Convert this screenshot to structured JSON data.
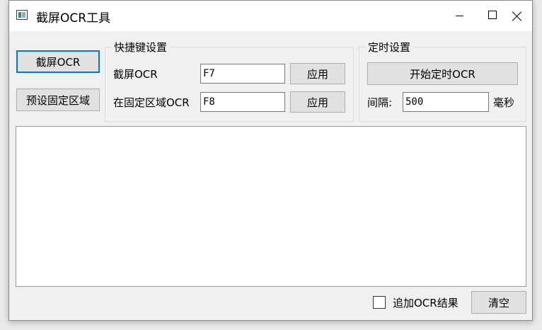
{
  "window": {
    "title": "截屏OCR工具"
  },
  "left": {
    "capture_button": "截屏OCR",
    "preset_region_button": "预设固定区域"
  },
  "hotkeys": {
    "group_title": "快捷键设置",
    "capture_label": "截屏OCR",
    "capture_value": "F7",
    "capture_apply": "应用",
    "fixed_label": "在固定区域OCR",
    "fixed_value": "F8",
    "fixed_apply": "应用"
  },
  "timer": {
    "group_title": "定时设置",
    "start_button": "开始定时OCR",
    "interval_label": "间隔:",
    "interval_value": "500",
    "unit_label": "毫秒"
  },
  "output": {
    "text": ""
  },
  "footer": {
    "append_label": "追加OCR结果",
    "append_checked": false,
    "clear_button": "清空"
  }
}
